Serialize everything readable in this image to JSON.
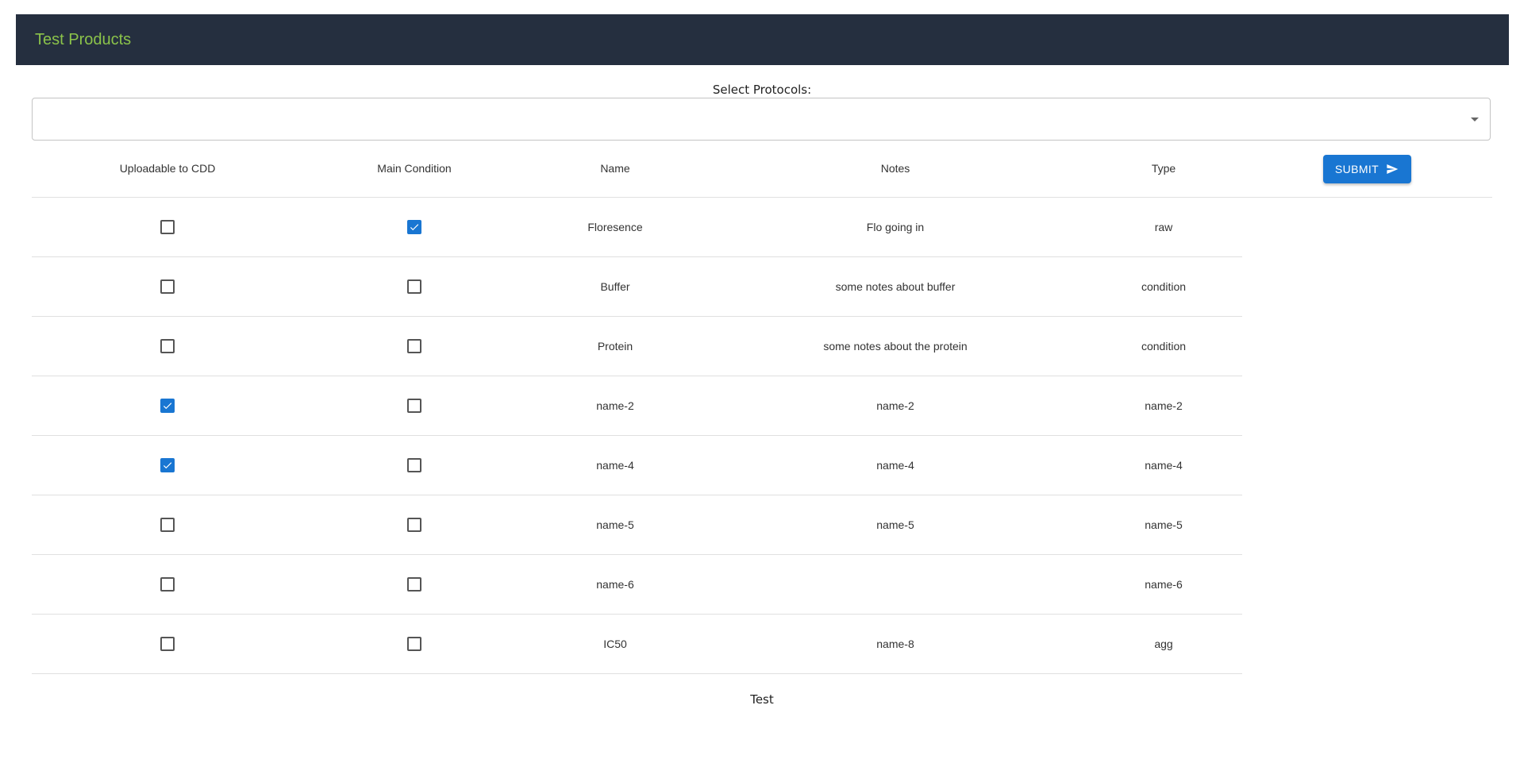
{
  "app": {
    "title": "Test Products"
  },
  "protocols": {
    "label": "Select Protocols:",
    "value": "",
    "dropdown_icon": "arrow-drop-down-icon"
  },
  "table": {
    "columns": {
      "uploadable": "Uploadable to CDD",
      "main_condition": "Main Condition",
      "name": "Name",
      "notes": "Notes",
      "type": "Type"
    },
    "submit_label": "SUBMIT",
    "submit_icon": "send-icon",
    "accent_color": "#1976d2",
    "rows": [
      {
        "uploadable": false,
        "main_condition": true,
        "name": "Floresence",
        "notes": "Flo going in",
        "type": "raw"
      },
      {
        "uploadable": false,
        "main_condition": false,
        "name": "Buffer",
        "notes": "some notes about buffer",
        "type": "condition"
      },
      {
        "uploadable": false,
        "main_condition": false,
        "name": "Protein",
        "notes": "some notes about the protein",
        "type": "condition"
      },
      {
        "uploadable": true,
        "main_condition": false,
        "name": "name-2",
        "notes": "name-2",
        "type": "name-2"
      },
      {
        "uploadable": true,
        "main_condition": false,
        "name": "name-4",
        "notes": "name-4",
        "type": "name-4"
      },
      {
        "uploadable": false,
        "main_condition": false,
        "name": "name-5",
        "notes": "name-5",
        "type": "name-5"
      },
      {
        "uploadable": false,
        "main_condition": false,
        "name": "name-6",
        "notes": "",
        "type": "name-6"
      },
      {
        "uploadable": false,
        "main_condition": false,
        "name": "IC50",
        "notes": "name-8",
        "type": "agg"
      }
    ]
  },
  "footer": {
    "text": "Test"
  },
  "colors": {
    "appbar_bg": "#252f3f",
    "title_color": "#8bc34a"
  }
}
